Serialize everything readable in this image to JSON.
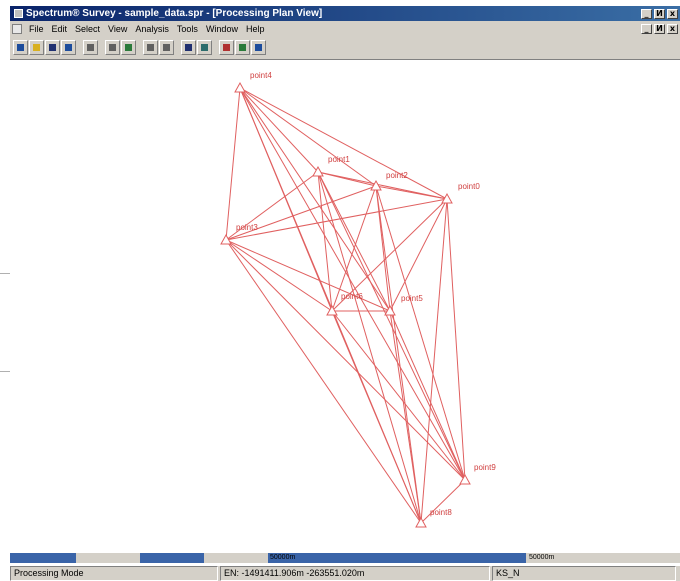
{
  "window": {
    "title": "Spectrum® Survey - sample_data.spr - [Processing Plan View]",
    "controls": [
      "_",
      "И",
      "x"
    ]
  },
  "menubar": {
    "items": [
      "File",
      "Edit",
      "Select",
      "View",
      "Analysis",
      "Tools",
      "Window",
      "Help"
    ],
    "controls": [
      "_",
      "И",
      "x"
    ]
  },
  "toolbar": {
    "buttons": [
      {
        "name": "new-project-icon",
        "color": "c-blue"
      },
      {
        "name": "open-folder-icon",
        "color": "c-yellow"
      },
      {
        "name": "save-icon",
        "color": "c-navy"
      },
      {
        "name": "export-icon",
        "color": "c-blue"
      },
      {
        "name": "print-icon",
        "color": "c-gray"
      },
      {
        "name": "edit-pencil-icon",
        "color": "c-gray"
      },
      {
        "name": "import-icon",
        "color": "c-green"
      },
      {
        "name": "properties-icon",
        "color": "c-gray"
      },
      {
        "name": "report-icon",
        "color": "c-gray"
      },
      {
        "name": "adjust-network-icon",
        "color": "c-navy"
      },
      {
        "name": "adjust-loop-icon",
        "color": "c-teal"
      },
      {
        "name": "process-icon",
        "color": "c-red"
      },
      {
        "name": "check-icon",
        "color": "c-green"
      },
      {
        "name": "globe-icon",
        "color": "c-blue"
      }
    ]
  },
  "plan_view": {
    "line_color": "#e06060",
    "points": [
      {
        "id": "point4",
        "label": "point4"
      },
      {
        "id": "point1",
        "label": "point1"
      },
      {
        "id": "point2",
        "label": "point2"
      },
      {
        "id": "point0",
        "label": "point0"
      },
      {
        "id": "point3",
        "label": "point3"
      },
      {
        "id": "point6",
        "label": "point6"
      },
      {
        "id": "point5",
        "label": "point5"
      },
      {
        "id": "point9",
        "label": "point9"
      },
      {
        "id": "point8",
        "label": "point8"
      }
    ],
    "baselines": [
      [
        "point4",
        "point1"
      ],
      [
        "point4",
        "point2"
      ],
      [
        "point4",
        "point0"
      ],
      [
        "point4",
        "point3"
      ],
      [
        "point4",
        "point6"
      ],
      [
        "point4",
        "point5"
      ],
      [
        "point4",
        "point9"
      ],
      [
        "point4",
        "point8"
      ],
      [
        "point1",
        "point2"
      ],
      [
        "point1",
        "point0"
      ],
      [
        "point1",
        "point3"
      ],
      [
        "point1",
        "point6"
      ],
      [
        "point1",
        "point5"
      ],
      [
        "point1",
        "point9"
      ],
      [
        "point1",
        "point8"
      ],
      [
        "point2",
        "point0"
      ],
      [
        "point2",
        "point3"
      ],
      [
        "point2",
        "point6"
      ],
      [
        "point2",
        "point5"
      ],
      [
        "point2",
        "point9"
      ],
      [
        "point2",
        "point8"
      ],
      [
        "point0",
        "point3"
      ],
      [
        "point0",
        "point6"
      ],
      [
        "point0",
        "point5"
      ],
      [
        "point0",
        "point9"
      ],
      [
        "point0",
        "point8"
      ],
      [
        "point3",
        "point6"
      ],
      [
        "point3",
        "point5"
      ],
      [
        "point3",
        "point9"
      ],
      [
        "point3",
        "point8"
      ],
      [
        "point6",
        "point5"
      ],
      [
        "point6",
        "point9"
      ],
      [
        "point6",
        "point8"
      ],
      [
        "point5",
        "point9"
      ],
      [
        "point5",
        "point8"
      ],
      [
        "point9",
        "point8"
      ]
    ]
  },
  "scale": {
    "label_mid": "50000m",
    "label_end": "50000m",
    "colors": {
      "dark": "#3a64a8",
      "light": "#d4d0c8"
    }
  },
  "statusbar": {
    "mode": "Processing Mode",
    "coords": "EN: -1491411.906m  -263551.020m",
    "projection": "KS_N"
  }
}
